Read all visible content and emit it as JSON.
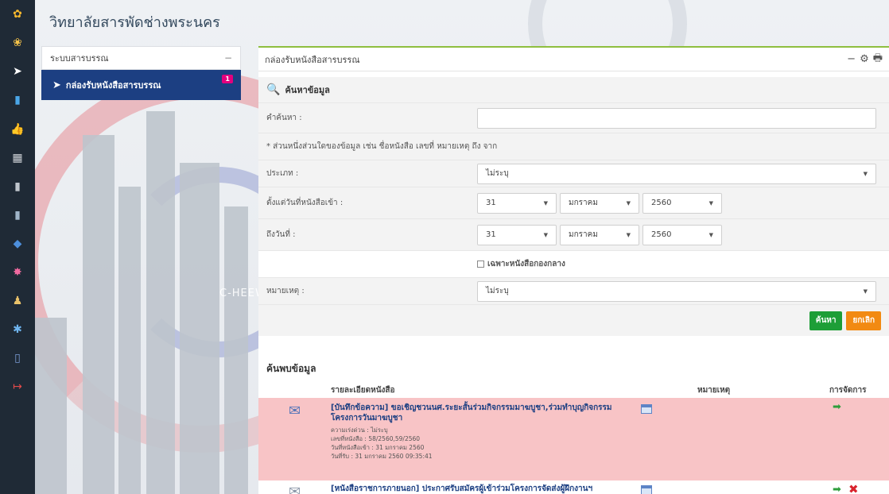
{
  "app_title": "วิทยาลัยสารพัดช่างพระนคร",
  "rail_icons": [
    "world-icon",
    "people-icon",
    "send-icon",
    "chart-icon",
    "thumbs-up-icon",
    "calendar-icon",
    "book-icon",
    "book-stack-icon",
    "car-icon",
    "flower-icon",
    "trophy-person-icon",
    "star-icon",
    "mobile-icon",
    "logout-icon"
  ],
  "rail_glyphs": [
    "✿",
    "❀",
    "➤",
    "▮",
    "👍",
    "▦",
    "▮",
    "▮",
    "◆",
    "✸",
    "♟",
    "✱",
    "▯",
    "↦"
  ],
  "bg_logo_text": "C-HEEWA",
  "menu": {
    "header": "ระบบสารบรรณ",
    "collapse": "−",
    "item_label": "กล่องรับหนังสือสารบรรณ",
    "item_badge": "1"
  },
  "panel": {
    "title": "กล่องรับหนังสือสารบรรณ",
    "tools": {
      "minimize": "−",
      "settings": "⚙",
      "print": "🖶"
    }
  },
  "search": {
    "title": "ค้นหาข้อมูล",
    "keyword_label": "คำค้นหา :",
    "keyword_value": "",
    "hint": "* ส่วนหนึ่งส่วนใดของข้อมูล เช่น ชื่อหนังสือ เลขที่ หมายเหตุ ถึง จาก",
    "type_label": "ประเภท :",
    "type_value": "ไม่ระบุ",
    "from_label": "ตั้งแต่วันที่หนังสือเข้า :",
    "from_day": "31",
    "from_month": "มกราคม",
    "from_year": "2560",
    "to_label": "ถึงวันที่ :",
    "to_day": "31",
    "to_month": "มกราคม",
    "to_year": "2560",
    "central_only": "เฉพาะหนังสือกองกลาง",
    "note_label": "หมายเหตุ :",
    "note_value": "ไม่ระบุ",
    "search_button": "ค้นหา",
    "cancel_button": "ยกเลิก"
  },
  "results": {
    "title": "ค้นพบข้อมูล",
    "columns": {
      "details": "รายละเอียดหนังสือ",
      "note": "หมายเหตุ",
      "actions": "การจัดการ"
    },
    "rows": [
      {
        "subject": "[บันทึกข้อความ] ขอเชิญชวนนศ.ระยะสั้นร่วมกิจกรรมมาฆบูชา,ร่วมทำบุญกิจกรรมโครงการวันมาฆบูชา",
        "urgency": "ความเร่งด่วน : ไม่ระบุ",
        "doc_no": "เลขที่หนังสือ : 58/2560,59/2560",
        "date_in": "วันที่หนังสือเข้า : 31 มกราคม 2560",
        "received": "วันที่รับ : 31 มกราคม 2560 09:35:41"
      },
      {
        "subject": "[หนังสือราชการภายนอก] ประกาศรับสมัครผู้เข้าร่วมโครงการจัดส่งผู้ฝึกงานฯ"
      }
    ]
  }
}
